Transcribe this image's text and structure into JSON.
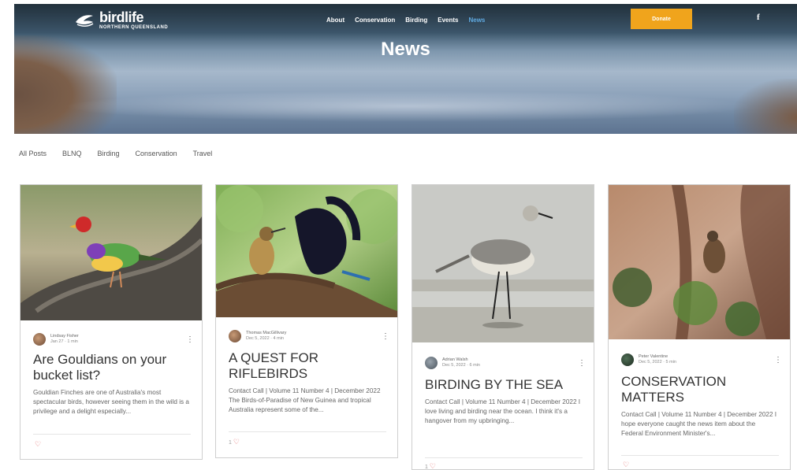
{
  "site": {
    "logo_name": "birdlife",
    "logo_sub": "NORTHERN QUEENSLAND"
  },
  "nav": [
    "About",
    "Conservation",
    "Birding",
    "Events",
    "News"
  ],
  "donate_label": "Donate",
  "facebook_label": "f",
  "page_title": "News",
  "categories": [
    "All Posts",
    "BLNQ",
    "Birding",
    "Conservation",
    "Travel"
  ],
  "posts": [
    {
      "author": "Lindsay Fisher",
      "date": "Jan 27 · 1 min",
      "title": "Are Gouldians on your bucket list?",
      "excerpt": "Gouldian Finches are one of Australia's most spectacular birds, however seeing them in the wild is a privilege and a delight especially...",
      "likes": ""
    },
    {
      "author": "Thomas MacGillivary",
      "date": "Dec 5, 2022 · 4 min",
      "title": "A QUEST FOR RIFLEBIRDS",
      "excerpt": "Contact Call | Volume 11 Number 4 | December 2022 The Birds-of-Paradise of New Guinea and tropical Australia represent some of the...",
      "likes": "1"
    },
    {
      "author": "Adrian Walsh",
      "date": "Dec 5, 2022 · 6 min",
      "title": "BIRDING BY THE SEA",
      "excerpt": "Contact Call | Volume 11 Number 4 | December 2022 I love living and birding near the ocean. I think it's a hangover from my upbringing...",
      "likes": "1"
    },
    {
      "author": "Peter Valentine",
      "date": "Dec 5, 2022 · 5 min",
      "title": "CONSERVATION MATTERS",
      "excerpt": "Contact Call | Volume 11 Number 4 | December 2022 I hope everyone caught the news item about the Federal Environment Minister's...",
      "likes": ""
    }
  ]
}
